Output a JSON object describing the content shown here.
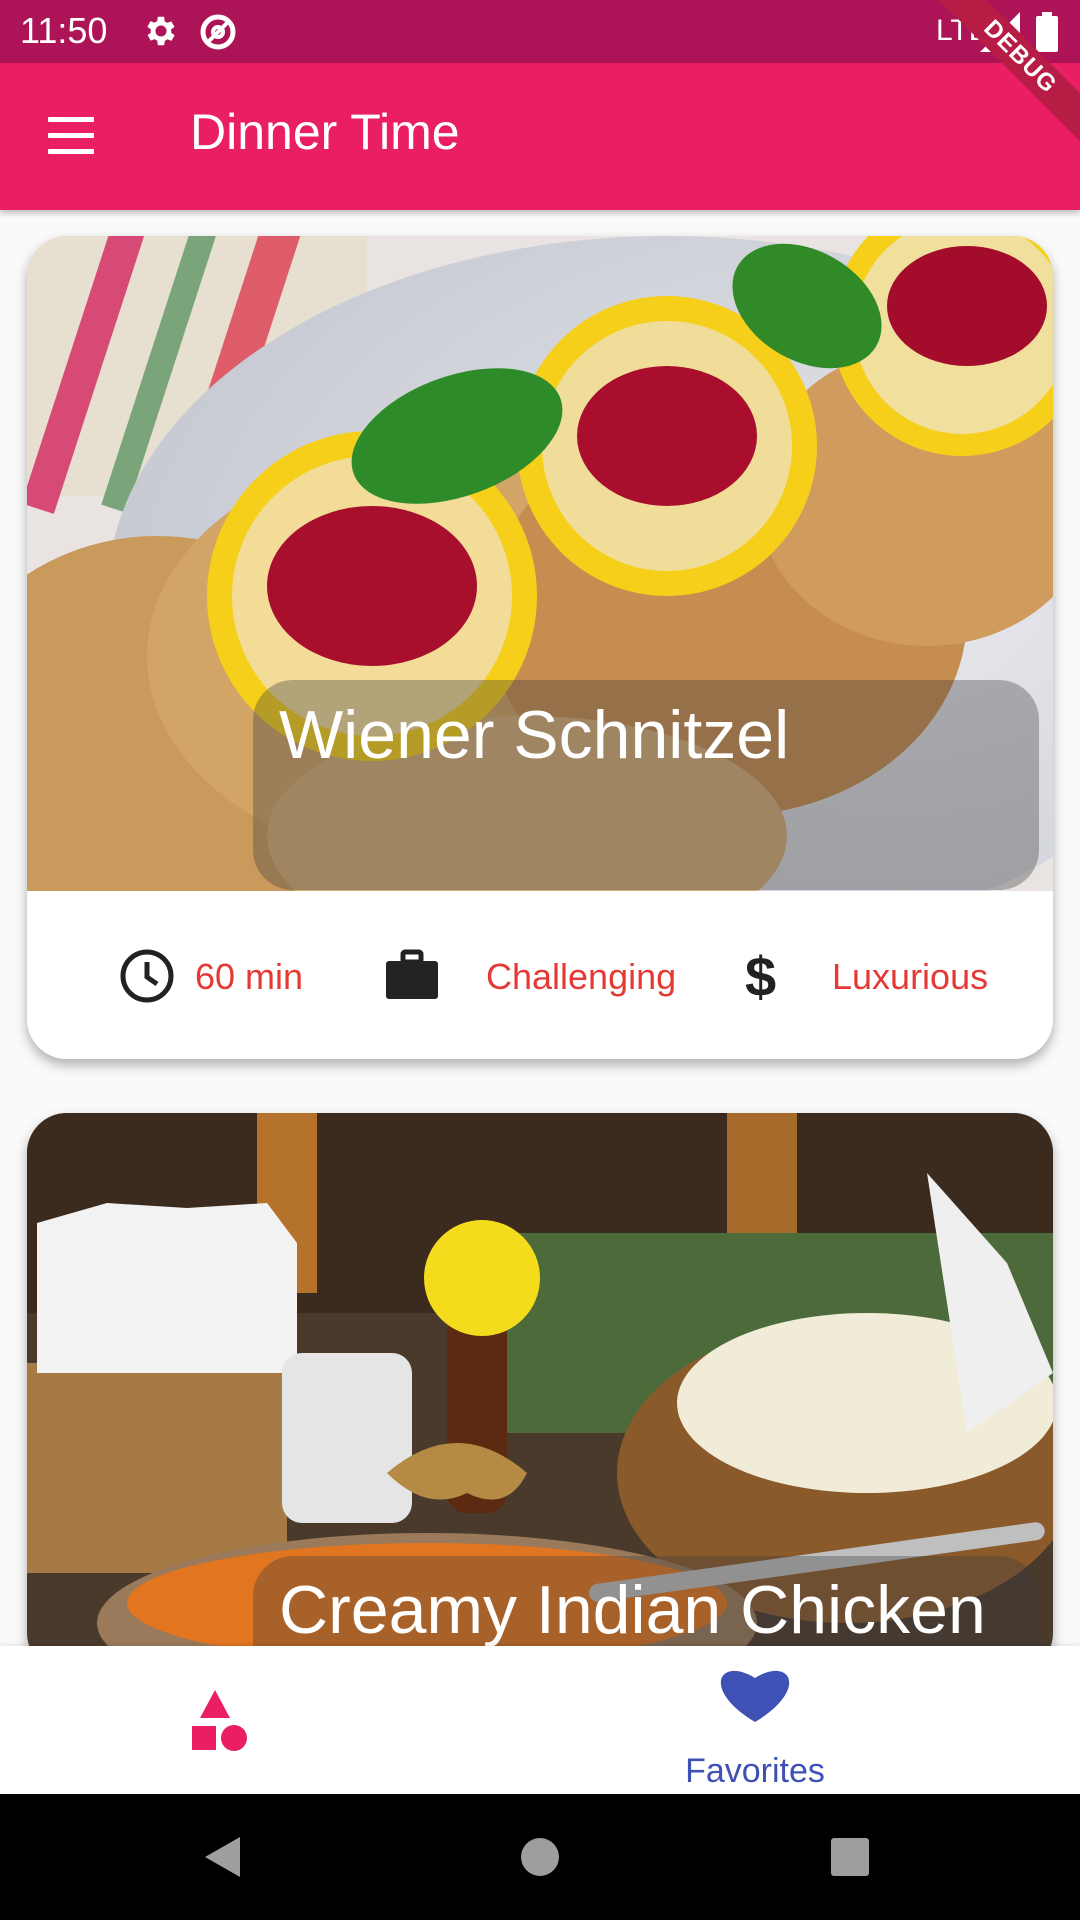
{
  "status_bar": {
    "time": "11:50",
    "network": "LTE",
    "debug_label": "DEBUG"
  },
  "app_bar": {
    "title": "Dinner Time"
  },
  "meals": [
    {
      "title": "Wiener Schnitzel",
      "duration": "60 min",
      "complexity": "Challenging",
      "affordability": "Luxurious"
    },
    {
      "title": "Creamy Indian Chicken"
    }
  ],
  "bottom_nav": {
    "categories_icon": "category-icon",
    "favorites_label": "Favorites",
    "favorites_icon": "heart-icon"
  },
  "colors": {
    "status_bar": "#ad1457",
    "primary": "#e91e63",
    "meta_text": "#e53935",
    "active_nav": "#3f51b5"
  }
}
